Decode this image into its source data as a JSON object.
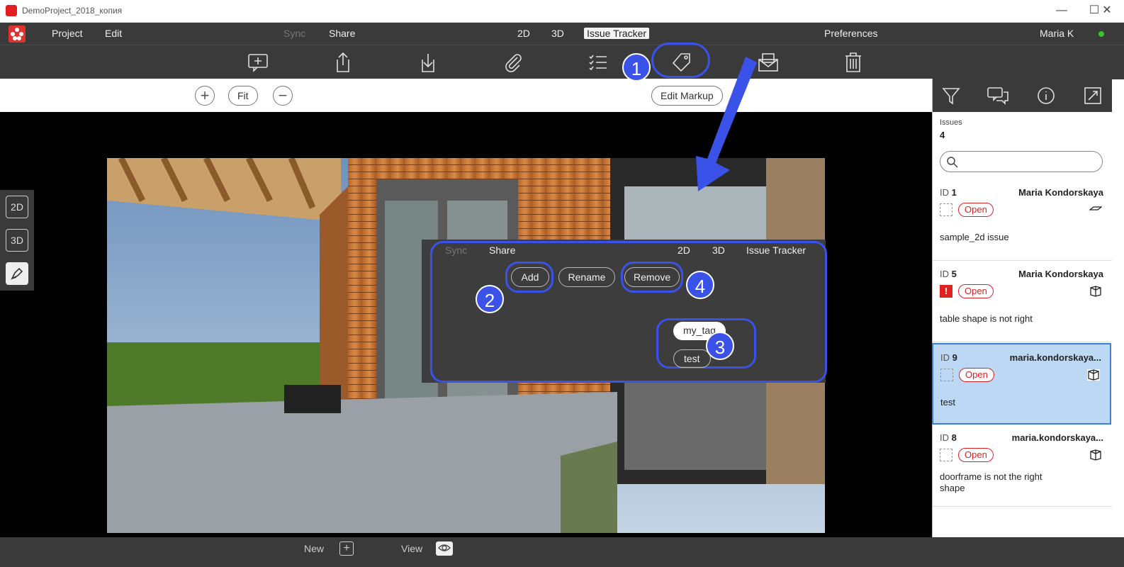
{
  "window": {
    "title": "DemoProject_2018_копия",
    "min": "—",
    "max": "☐",
    "close": "✕"
  },
  "menu": {
    "project": "Project",
    "edit": "Edit",
    "sync": "Sync",
    "share": "Share",
    "view_2d": "2D",
    "view_3d": "3D",
    "issue_tracker": "Issue Tracker",
    "preferences": "Preferences",
    "user": "Maria K",
    "online_color": "#35c235"
  },
  "toolbar": {
    "icons": [
      "new-comment-icon",
      "upload-icon",
      "download-icon",
      "attach-icon",
      "checklist-icon",
      "tag-icon",
      "email-icon",
      "trash-icon"
    ]
  },
  "viewctl": {
    "zoom_in": "+",
    "fit": "Fit",
    "zoom_out": "−",
    "edit_markup": "Edit Markup"
  },
  "lefttools": {
    "t2d": "2D",
    "t3d": "3D"
  },
  "tagpopup": {
    "sync": "Sync",
    "share": "Share",
    "v2d": "2D",
    "v3d": "3D",
    "issue_tracker": "Issue Tracker",
    "add": "Add",
    "rename": "Rename",
    "remove": "Remove",
    "tags": [
      "my_tag",
      "test"
    ]
  },
  "annotations": {
    "b1": "1",
    "b2": "2",
    "b3": "3",
    "b4": "4",
    "color": "#3a52e8"
  },
  "rightpanel": {
    "issues_label": "Issues",
    "issues_count": "4",
    "search_placeholder": "",
    "issues": [
      {
        "id_label": "ID",
        "id": "1",
        "author": "Maria Kondorskaya",
        "status": "Open",
        "desc": "sample_2d issue",
        "kind": "2d-markup-icon"
      },
      {
        "id_label": "ID",
        "id": "5",
        "author": "Maria Kondorskaya",
        "status": "Open",
        "desc": "table shape is not right",
        "kind": "3d-view-icon",
        "priority": "!"
      },
      {
        "id_label": "ID",
        "id": "9",
        "author": "maria.kondorskaya...",
        "status": "Open",
        "desc": "test",
        "kind": "3d-view-icon"
      },
      {
        "id_label": "ID",
        "id": "8",
        "author": "maria.kondorskaya...",
        "status": "Open",
        "desc": "doorframe is not the right shape",
        "kind": "3d-view-icon"
      }
    ]
  },
  "bottombar": {
    "new": "New",
    "view": "View"
  }
}
